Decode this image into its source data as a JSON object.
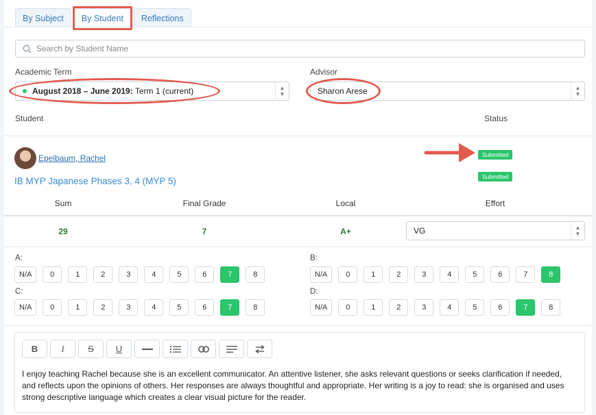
{
  "tabs": [
    {
      "label": "By Subject",
      "active": false
    },
    {
      "label": "By Student",
      "active": true
    },
    {
      "label": "Reflections",
      "active": false
    }
  ],
  "search": {
    "placeholder": "Search by Student Name"
  },
  "filters": {
    "term_label": "Academic Term",
    "term_bold": "August 2018 – June 2019:",
    "term_rest": " Term 1 (current)",
    "advisor_label": "Advisor",
    "advisor_value": "Sharon Arese"
  },
  "table": {
    "student_header": "Student",
    "status_header": "Status"
  },
  "student": {
    "name": "Epelbaum, Rachel",
    "course": "IB MYP Japanese Phases 3, 4 (MYP 5)",
    "status_1": "Submitted",
    "status_2": "Submitted"
  },
  "grades": {
    "headers": {
      "sum": "Sum",
      "final": "Final Grade",
      "local": "Local",
      "effort": "Effort"
    },
    "sum": "29",
    "final": "7",
    "local": "A+",
    "effort": "VG"
  },
  "criteria": [
    {
      "label": "A:",
      "options": [
        "N/A",
        "0",
        "1",
        "2",
        "3",
        "4",
        "5",
        "6",
        "7",
        "8"
      ],
      "selected": "7"
    },
    {
      "label": "B:",
      "options": [
        "N/A",
        "0",
        "1",
        "2",
        "3",
        "4",
        "5",
        "6",
        "7",
        "8"
      ],
      "selected": "8"
    },
    {
      "label": "C:",
      "options": [
        "N/A",
        "0",
        "1",
        "2",
        "3",
        "4",
        "5",
        "6",
        "7",
        "8"
      ],
      "selected": "7"
    },
    {
      "label": "D:",
      "options": [
        "N/A",
        "0",
        "1",
        "2",
        "3",
        "4",
        "5",
        "6",
        "7",
        "8"
      ],
      "selected": "7"
    }
  ],
  "editor": {
    "toolbar": [
      "bold-icon",
      "italic-icon",
      "strikethrough-icon",
      "underline-icon",
      "horizontal-rule-icon",
      "list-icon",
      "link-icon",
      "align-icon",
      "swap-icon"
    ],
    "text": "I enjoy teaching Rachel because she is an excellent communicator. An attentive listener, she asks relevant questions or seeks clarification if needed, and reflects upon the opinions of others. Her responses are always thoughtful and appropriate. Her writing is a joy to read: she is organised and uses strong descriptive language which creates a clear visual picture for the reader."
  },
  "colors": {
    "accent": "#3a7bbf",
    "success": "#2bc56b",
    "annotation": "#e25b4f"
  }
}
